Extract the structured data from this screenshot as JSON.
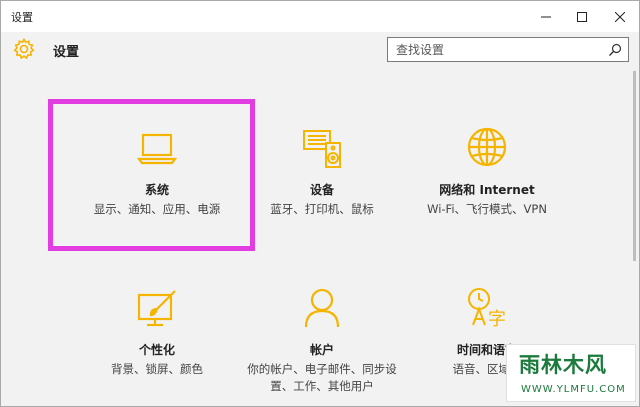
{
  "window": {
    "title": "设置"
  },
  "header": {
    "app_title": "设置",
    "search_placeholder": "查找设置"
  },
  "tiles": [
    {
      "id": "system",
      "title": "系统",
      "desc": "显示、通知、应用、电源",
      "icon": "laptop-icon",
      "highlighted": true
    },
    {
      "id": "devices",
      "title": "设备",
      "desc": "蓝牙、打印机、鼠标",
      "icon": "devices-icon"
    },
    {
      "id": "network",
      "title": "网络和 Internet",
      "desc": "Wi-Fi、飞行模式、VPN",
      "icon": "globe-icon"
    },
    {
      "id": "personalization",
      "title": "个性化",
      "desc": "背景、锁屏、颜色",
      "icon": "paint-icon"
    },
    {
      "id": "accounts",
      "title": "帐户",
      "desc": "你的帐户、电子邮件、同步设置、工作、其他用户",
      "icon": "person-icon"
    },
    {
      "id": "time_language",
      "title": "时间和语言",
      "desc": "语音、区域、",
      "icon": "time-language-icon"
    }
  ],
  "watermark": {
    "title": "雨林木风",
    "url": "WWW.YLMFU.COM"
  },
  "colors": {
    "accent": "#f5b400",
    "highlight": "#e23de0",
    "watermark": "#1b7a3c"
  }
}
